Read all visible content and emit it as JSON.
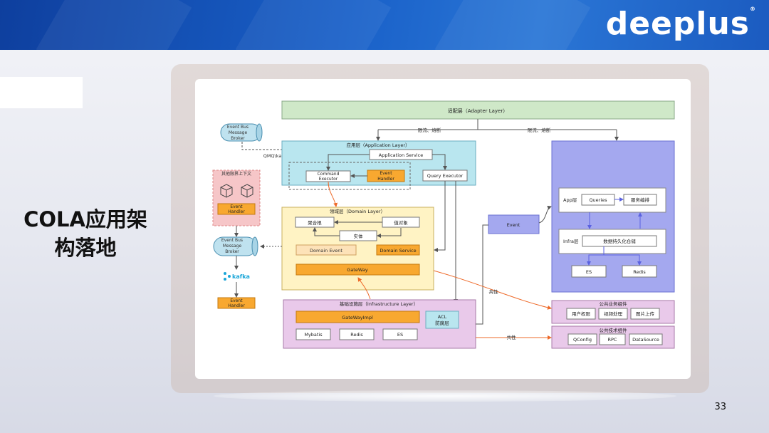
{
  "header": {
    "logo_text": "deeplus"
  },
  "slide": {
    "title_line1": "COLA应用架",
    "title_line2": "构落地",
    "page_number": "33"
  },
  "diagram": {
    "adapter_layer": "适配层（Adapter Layer）",
    "flow_control_left": "限流、熔断",
    "flow_control_right": "限流、熔断",
    "event_bus_top": [
      "Event Bus",
      "Message",
      "Broker"
    ],
    "qmq_label": "QMQ\\kafka订阅事件消息",
    "application_layer": "应用层（Application Layer）",
    "application_service": "Application Service",
    "command_executor": [
      "Command",
      "Executor"
    ],
    "event_handler_app": [
      "Event",
      "Handler"
    ],
    "query_executor": "Query Executor",
    "other_context": "其他限界上下文",
    "event_handler_ctx": [
      "Event",
      "Handler"
    ],
    "domain_layer": "领域层（Domain Layer）",
    "aggregate_root": "聚合根",
    "value_object": "值对象",
    "entity": "实体",
    "domain_event": "Domain Event",
    "domain_service": "Domain Service",
    "gateway": "GateWay",
    "event_bus_mid": [
      "Event Bus",
      "Message",
      "Broker"
    ],
    "kafka_label": "kafka",
    "event_handler_bottom": [
      "Event",
      "Handler"
    ],
    "infrastructure_layer": "基础设施层（Infrastructure Layer）",
    "gateway_impl": "GateWayImpl",
    "acl": [
      "ACL",
      "防腐层"
    ],
    "mybatis": "Mybatis",
    "redis_infra": "Redis",
    "es_infra": "ES",
    "event_center": "Event",
    "app_layer_label": "App层",
    "queries": "Queries",
    "service_orchestration": "服务编排",
    "infra_layer_label": "Infra层",
    "data_persistence": "数据持久化仓储",
    "es_right": "ES",
    "redis_right": "Redis",
    "shared_label_1": "共性",
    "shared_label_2": "共性",
    "public_business_components": "公共业务组件",
    "user_permission": "用户权限",
    "video_processing": "视频处理",
    "image_upload": "图片上传",
    "public_tech_components": "公共技术组件",
    "qconfig": "QConfig",
    "rpc": "RPC",
    "datasource": "DataSource"
  },
  "colors": {
    "adapter": "#cfe8c8",
    "application": "#b9e6ef",
    "domain": "#fff3c4",
    "infra": "#e9c9ea",
    "right_panel": "#a4a8ef",
    "orange": "#f8a830",
    "context": "#f6c6c8",
    "event_bus": "#bfe2ef",
    "arrow_orange": "#ee6a2a"
  }
}
